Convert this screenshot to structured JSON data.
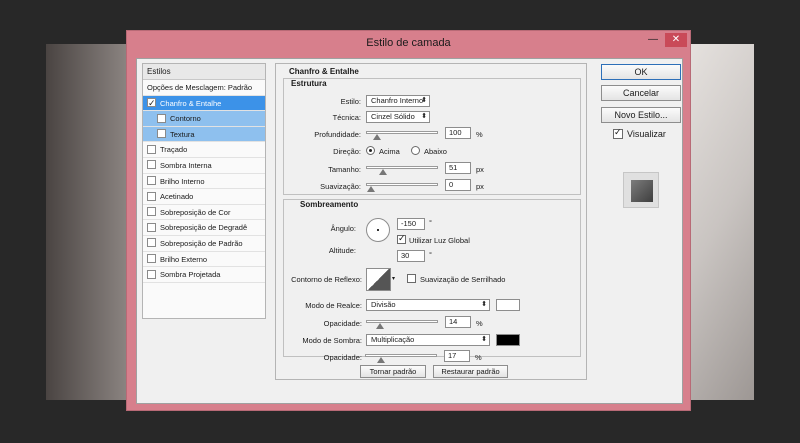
{
  "window": {
    "title": "Estilo de camada",
    "minimize": "—",
    "close": "✕"
  },
  "styles": {
    "header": "Estilos",
    "items": [
      {
        "label": "Opções de Mesclagem: Padrão",
        "checkbox": false
      },
      {
        "label": "Chanfro & Entalhe",
        "checkbox": true,
        "checked": true,
        "selected": true
      },
      {
        "label": "Contorno",
        "checkbox": true,
        "checked": false,
        "sub": true
      },
      {
        "label": "Textura",
        "checkbox": true,
        "checked": false,
        "sub": true
      },
      {
        "label": "Traçado",
        "checkbox": true,
        "checked": false
      },
      {
        "label": "Sombra Interna",
        "checkbox": true,
        "checked": false
      },
      {
        "label": "Brilho Interno",
        "checkbox": true,
        "checked": false
      },
      {
        "label": "Acetinado",
        "checkbox": true,
        "checked": false
      },
      {
        "label": "Sobreposição de Cor",
        "checkbox": true,
        "checked": false
      },
      {
        "label": "Sobreposição de Degradê",
        "checkbox": true,
        "checked": false
      },
      {
        "label": "Sobreposição de Padrão",
        "checkbox": true,
        "checked": false
      },
      {
        "label": "Brilho Externo",
        "checkbox": true,
        "checked": false
      },
      {
        "label": "Sombra Projetada",
        "checkbox": true,
        "checked": false
      }
    ]
  },
  "bevel": {
    "title": "Chanfro & Entalhe",
    "structure": {
      "title": "Estrutura",
      "style_label": "Estilo:",
      "style_value": "Chanfro Interno",
      "technique_label": "Técnica:",
      "technique_value": "Cinzel Sólido",
      "depth_label": "Profundidade:",
      "depth_value": "100",
      "depth_unit": "%",
      "depth_level": 0.1,
      "direction_label": "Direção:",
      "direction_up": "Acima",
      "direction_down": "Abaixo",
      "size_label": "Tamanho:",
      "size_value": "51",
      "size_unit": "px",
      "size_level": 0.2,
      "soften_label": "Suavização:",
      "soften_value": "0",
      "soften_unit": "px",
      "soften_level": 0.0
    },
    "shading": {
      "title": "Sombreamento",
      "angle_label": "Ângulo:",
      "angle_value": "-150",
      "angle_unit": "°",
      "global_light_label": "Utilizar Luz Global",
      "global_light": true,
      "altitude_label": "Altitude:",
      "altitude_value": "30",
      "altitude_unit": "°",
      "gloss_label": "Contorno de Reflexo:",
      "antialias_label": "Suavização de Serrilhado",
      "antialias": false,
      "highlight_mode_label": "Modo de Realce:",
      "highlight_mode_value": "Divisão",
      "highlight_color": "#ffffff",
      "highlight_opacity_label": "Opacidade:",
      "highlight_opacity_value": "14",
      "highlight_opacity_unit": "%",
      "highlight_opacity_level": 0.14,
      "shadow_mode_label": "Modo de Sombra:",
      "shadow_mode_value": "Multiplicação",
      "shadow_color": "#000000",
      "shadow_opacity_label": "Opacidade:",
      "shadow_opacity_value": "17",
      "shadow_opacity_unit": "%",
      "shadow_opacity_level": 0.17
    },
    "make_default": "Tornar padrão",
    "reset_default": "Restaurar padrão"
  },
  "actions": {
    "ok": "OK",
    "cancel": "Cancelar",
    "new_style": "Novo Estilo...",
    "preview_label": "Visualizar",
    "preview_checked": true
  },
  "colors": {
    "dialog_frame": "#d77f8c",
    "selection": "#3c92e8",
    "sub_selection": "#8ec0ee"
  }
}
